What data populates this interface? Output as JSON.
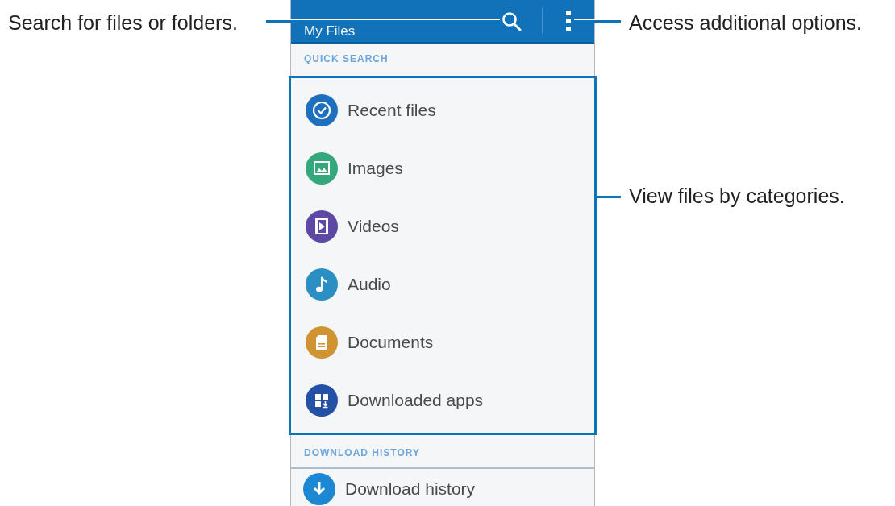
{
  "app_bar": {
    "title": "My Files"
  },
  "sections": [
    {
      "header": "QUICK SEARCH",
      "highlighted": true,
      "items": [
        {
          "label": "Recent files",
          "kind": "clock",
          "color": "#1f6fbf"
        },
        {
          "label": "Images",
          "kind": "image",
          "color": "#35a77c"
        },
        {
          "label": "Videos",
          "kind": "video",
          "color": "#5d48a3"
        },
        {
          "label": "Audio",
          "kind": "music",
          "color": "#2b8fc4"
        },
        {
          "label": "Documents",
          "kind": "document",
          "color": "#cf9431"
        },
        {
          "label": "Downloaded apps",
          "kind": "apps",
          "color": "#2451a6"
        }
      ]
    },
    {
      "header": "DOWNLOAD HISTORY",
      "highlighted": false,
      "items": [
        {
          "label": "Download history",
          "kind": "download",
          "color": "#1c87d3"
        }
      ]
    }
  ],
  "callouts": [
    {
      "text": "Search for files or folders."
    },
    {
      "text": "Access additional options."
    },
    {
      "text": "View files by categories."
    }
  ]
}
